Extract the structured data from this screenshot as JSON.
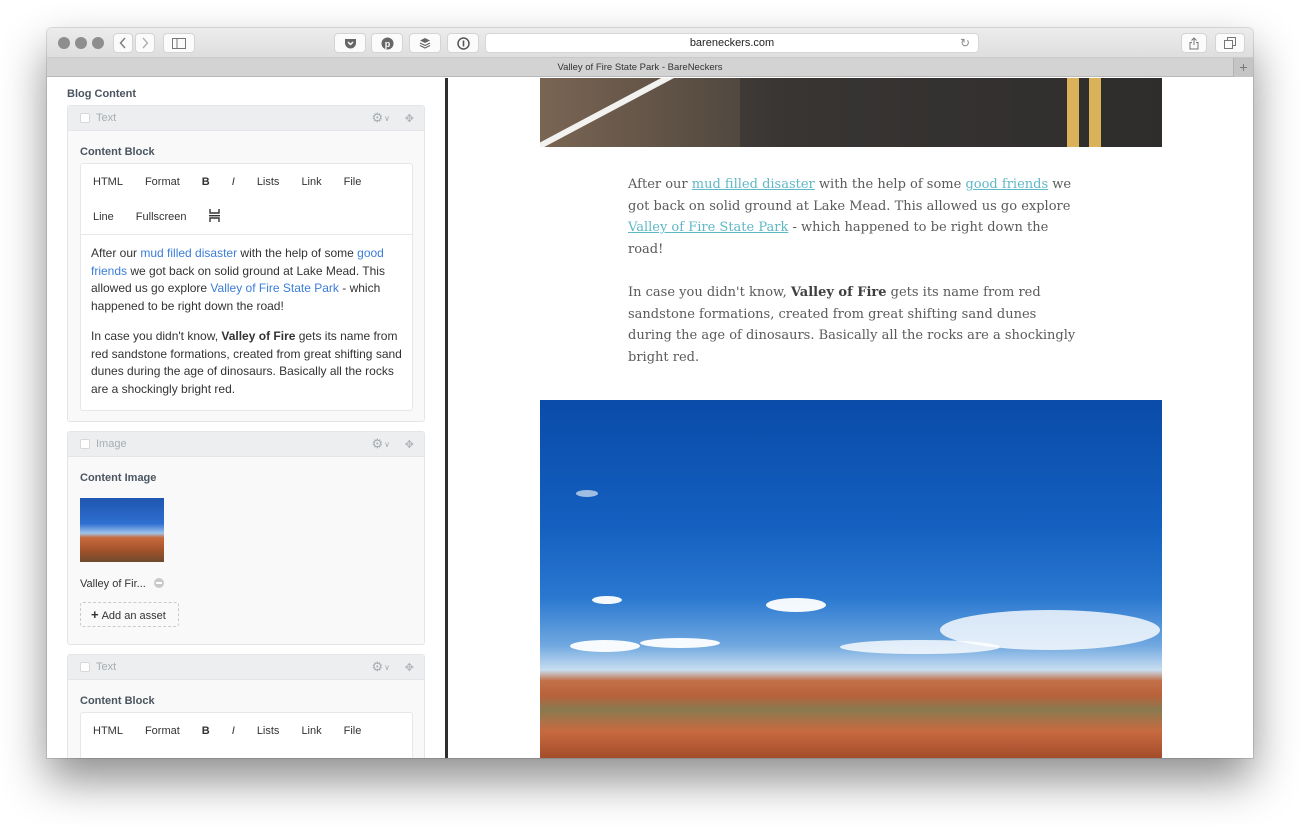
{
  "browser": {
    "url": "bareneckers.com",
    "tab_title": "Valley of Fire State Park - BareNeckers",
    "toolbar_icons": [
      "back-icon",
      "forward-icon",
      "sidebar-icon",
      "pocket-icon",
      "pinterest-icon",
      "buffer-icon",
      "onepassword-icon",
      "reload-icon",
      "share-icon",
      "tabs-icon",
      "new-tab-icon"
    ]
  },
  "cms": {
    "section_title": "Blog Content",
    "blocks": [
      {
        "type": "Text",
        "field_label": "Content Block",
        "toolbar_row1": [
          "HTML",
          "Format",
          "B",
          "I",
          "Lists",
          "Link",
          "File"
        ],
        "toolbar_row2": [
          "Line",
          "Fullscreen"
        ],
        "paragraph1": {
          "t1": "After our ",
          "link1": "mud filled disaster",
          "t2": " with the help of some ",
          "link2": "good friends",
          "t3": " we got back on solid ground at Lake Mead. This allowed us go explore ",
          "link3": "Valley of Fire State Park",
          "t4": " - which happened to be right down the road!"
        },
        "paragraph2": {
          "t1": "In case you didn't know, ",
          "bold": "Valley of Fire",
          "t2": " gets its name from red sandstone formations, created from great shifting sand dunes during the age of dinosaurs. Basically all the rocks are a shockingly bright red."
        }
      },
      {
        "type": "Image",
        "field_label": "Content Image",
        "asset_name": "Valley of Fir...",
        "add_asset_label": "Add an asset"
      },
      {
        "type": "Text",
        "field_label": "Content Block",
        "toolbar_row1": [
          "HTML",
          "Format",
          "B",
          "I",
          "Lists",
          "Link",
          "File"
        ]
      }
    ]
  },
  "article": {
    "paragraph1": {
      "t1": "After our ",
      "link1": "mud filled disaster",
      "t2": " with the help of some ",
      "link2": "good friends",
      "t3": " we got back on solid ground at Lake Mead. This allowed us go explore ",
      "link3": "Valley of Fire State Park",
      "t4": " - which happened to be right down the road!"
    },
    "paragraph2": {
      "t1": "In case you didn't know, ",
      "bold": "Valley of Fire",
      "t2": " gets its name from red sandstone formations, created from great shifting sand dunes during the age of dinosaurs. Basically all the rocks are a shockingly bright red."
    }
  },
  "colors": {
    "cms_link": "#3b7dd8",
    "article_link": "#5fb8c6"
  }
}
